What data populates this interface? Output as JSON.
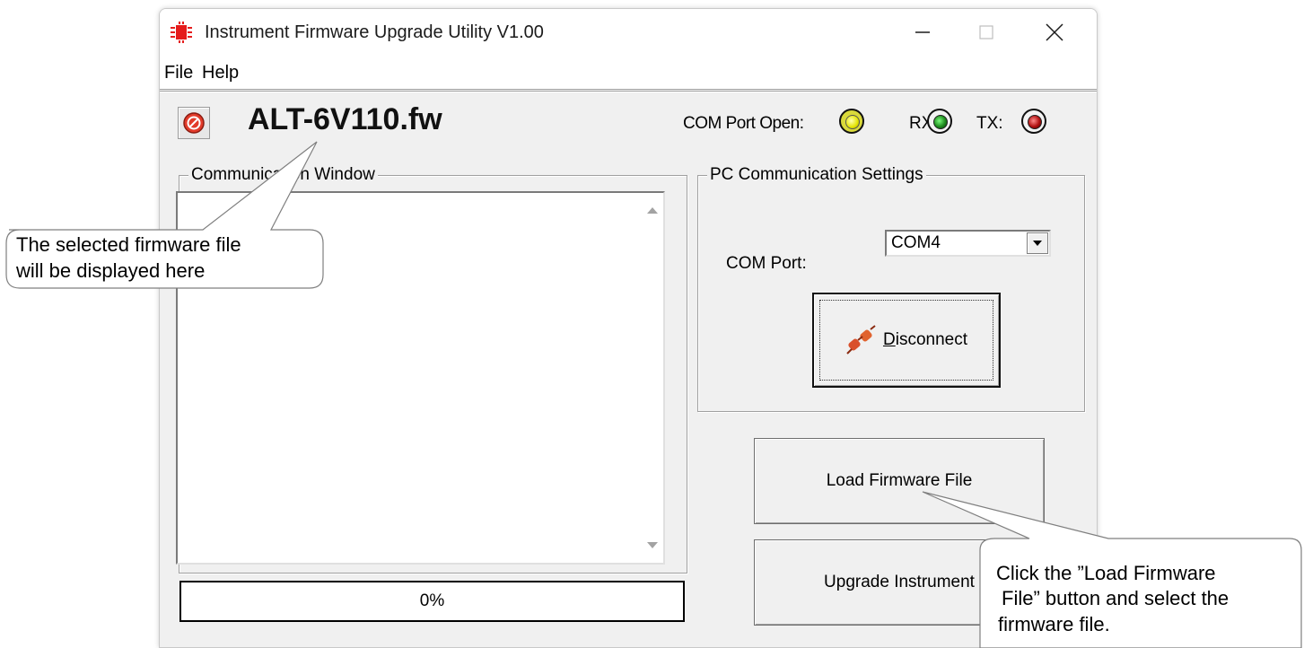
{
  "window": {
    "title": "Instrument Firmware Upgrade Utility V1.00",
    "menu": [
      "File",
      "Help"
    ]
  },
  "toolbar": {
    "firmware_file": "ALT-6V110.fw",
    "com_open_label": "COM Port Open:",
    "rx_label": "RX:",
    "tx_label": "TX:",
    "led_colors": {
      "com_open": "#e4e400",
      "rx": "#1e8a1e",
      "tx": "#b01010"
    }
  },
  "comm_window": {
    "title": "Communication Window",
    "content": ""
  },
  "pc_settings": {
    "title": "PC Communication Settings",
    "com_port_label": "COM Port:",
    "com_port_value": "COM4",
    "disconnect_prefix": "D",
    "disconnect_rest": "isconnect"
  },
  "buttons": {
    "load": "Load Firmware File",
    "upgrade": "Upgrade Instrument"
  },
  "progress": {
    "value": "0%"
  },
  "callouts": {
    "firmware_line1": "The selected firmware file",
    "firmware_line2": "will be displayed here",
    "load_line1": "Click the ”Load Firmware",
    "load_line2": "File” button and select the",
    "load_line3": "firmware file."
  },
  "icons": [
    "app-chip-icon",
    "minimize-icon",
    "maximize-icon",
    "close-icon",
    "stop-icon",
    "plug-icon",
    "chevron-down-icon"
  ]
}
